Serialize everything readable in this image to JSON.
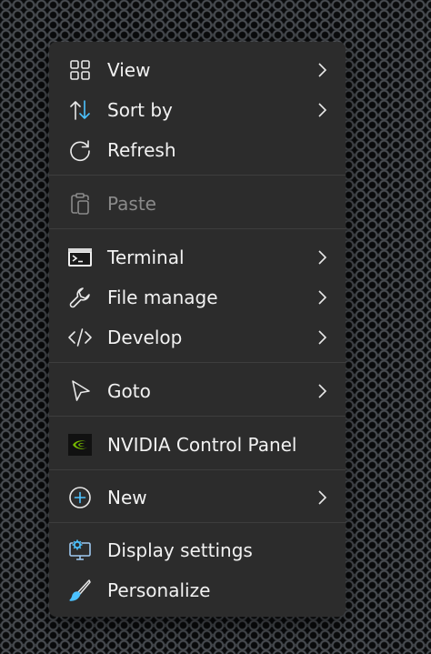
{
  "menu": {
    "items": [
      {
        "label": "View",
        "icon": "grid-icon",
        "submenu": true
      },
      {
        "label": "Sort by",
        "icon": "sort-icon",
        "submenu": true
      },
      {
        "label": "Refresh",
        "icon": "refresh-icon",
        "submenu": false
      },
      {
        "label": "Paste",
        "icon": "paste-icon",
        "submenu": false,
        "disabled": true
      },
      {
        "label": "Terminal",
        "icon": "terminal-icon",
        "submenu": true
      },
      {
        "label": "File manage",
        "icon": "wrench-icon",
        "submenu": true
      },
      {
        "label": "Develop",
        "icon": "code-icon",
        "submenu": true
      },
      {
        "label": "Goto",
        "icon": "cursor-icon",
        "submenu": true
      },
      {
        "label": "NVIDIA Control Panel",
        "icon": "nvidia-icon",
        "submenu": false
      },
      {
        "label": "New",
        "icon": "plus-circle-icon",
        "submenu": true
      },
      {
        "label": "Display settings",
        "icon": "display-settings-icon",
        "submenu": false
      },
      {
        "label": "Personalize",
        "icon": "brush-icon",
        "submenu": false
      }
    ]
  },
  "colors": {
    "menu_background": "#2c2c2c",
    "text": "#f2f2f2",
    "disabled_text": "#8a8a8a",
    "accent_blue": "#4cc2ff",
    "nvidia_green": "#76b900"
  }
}
